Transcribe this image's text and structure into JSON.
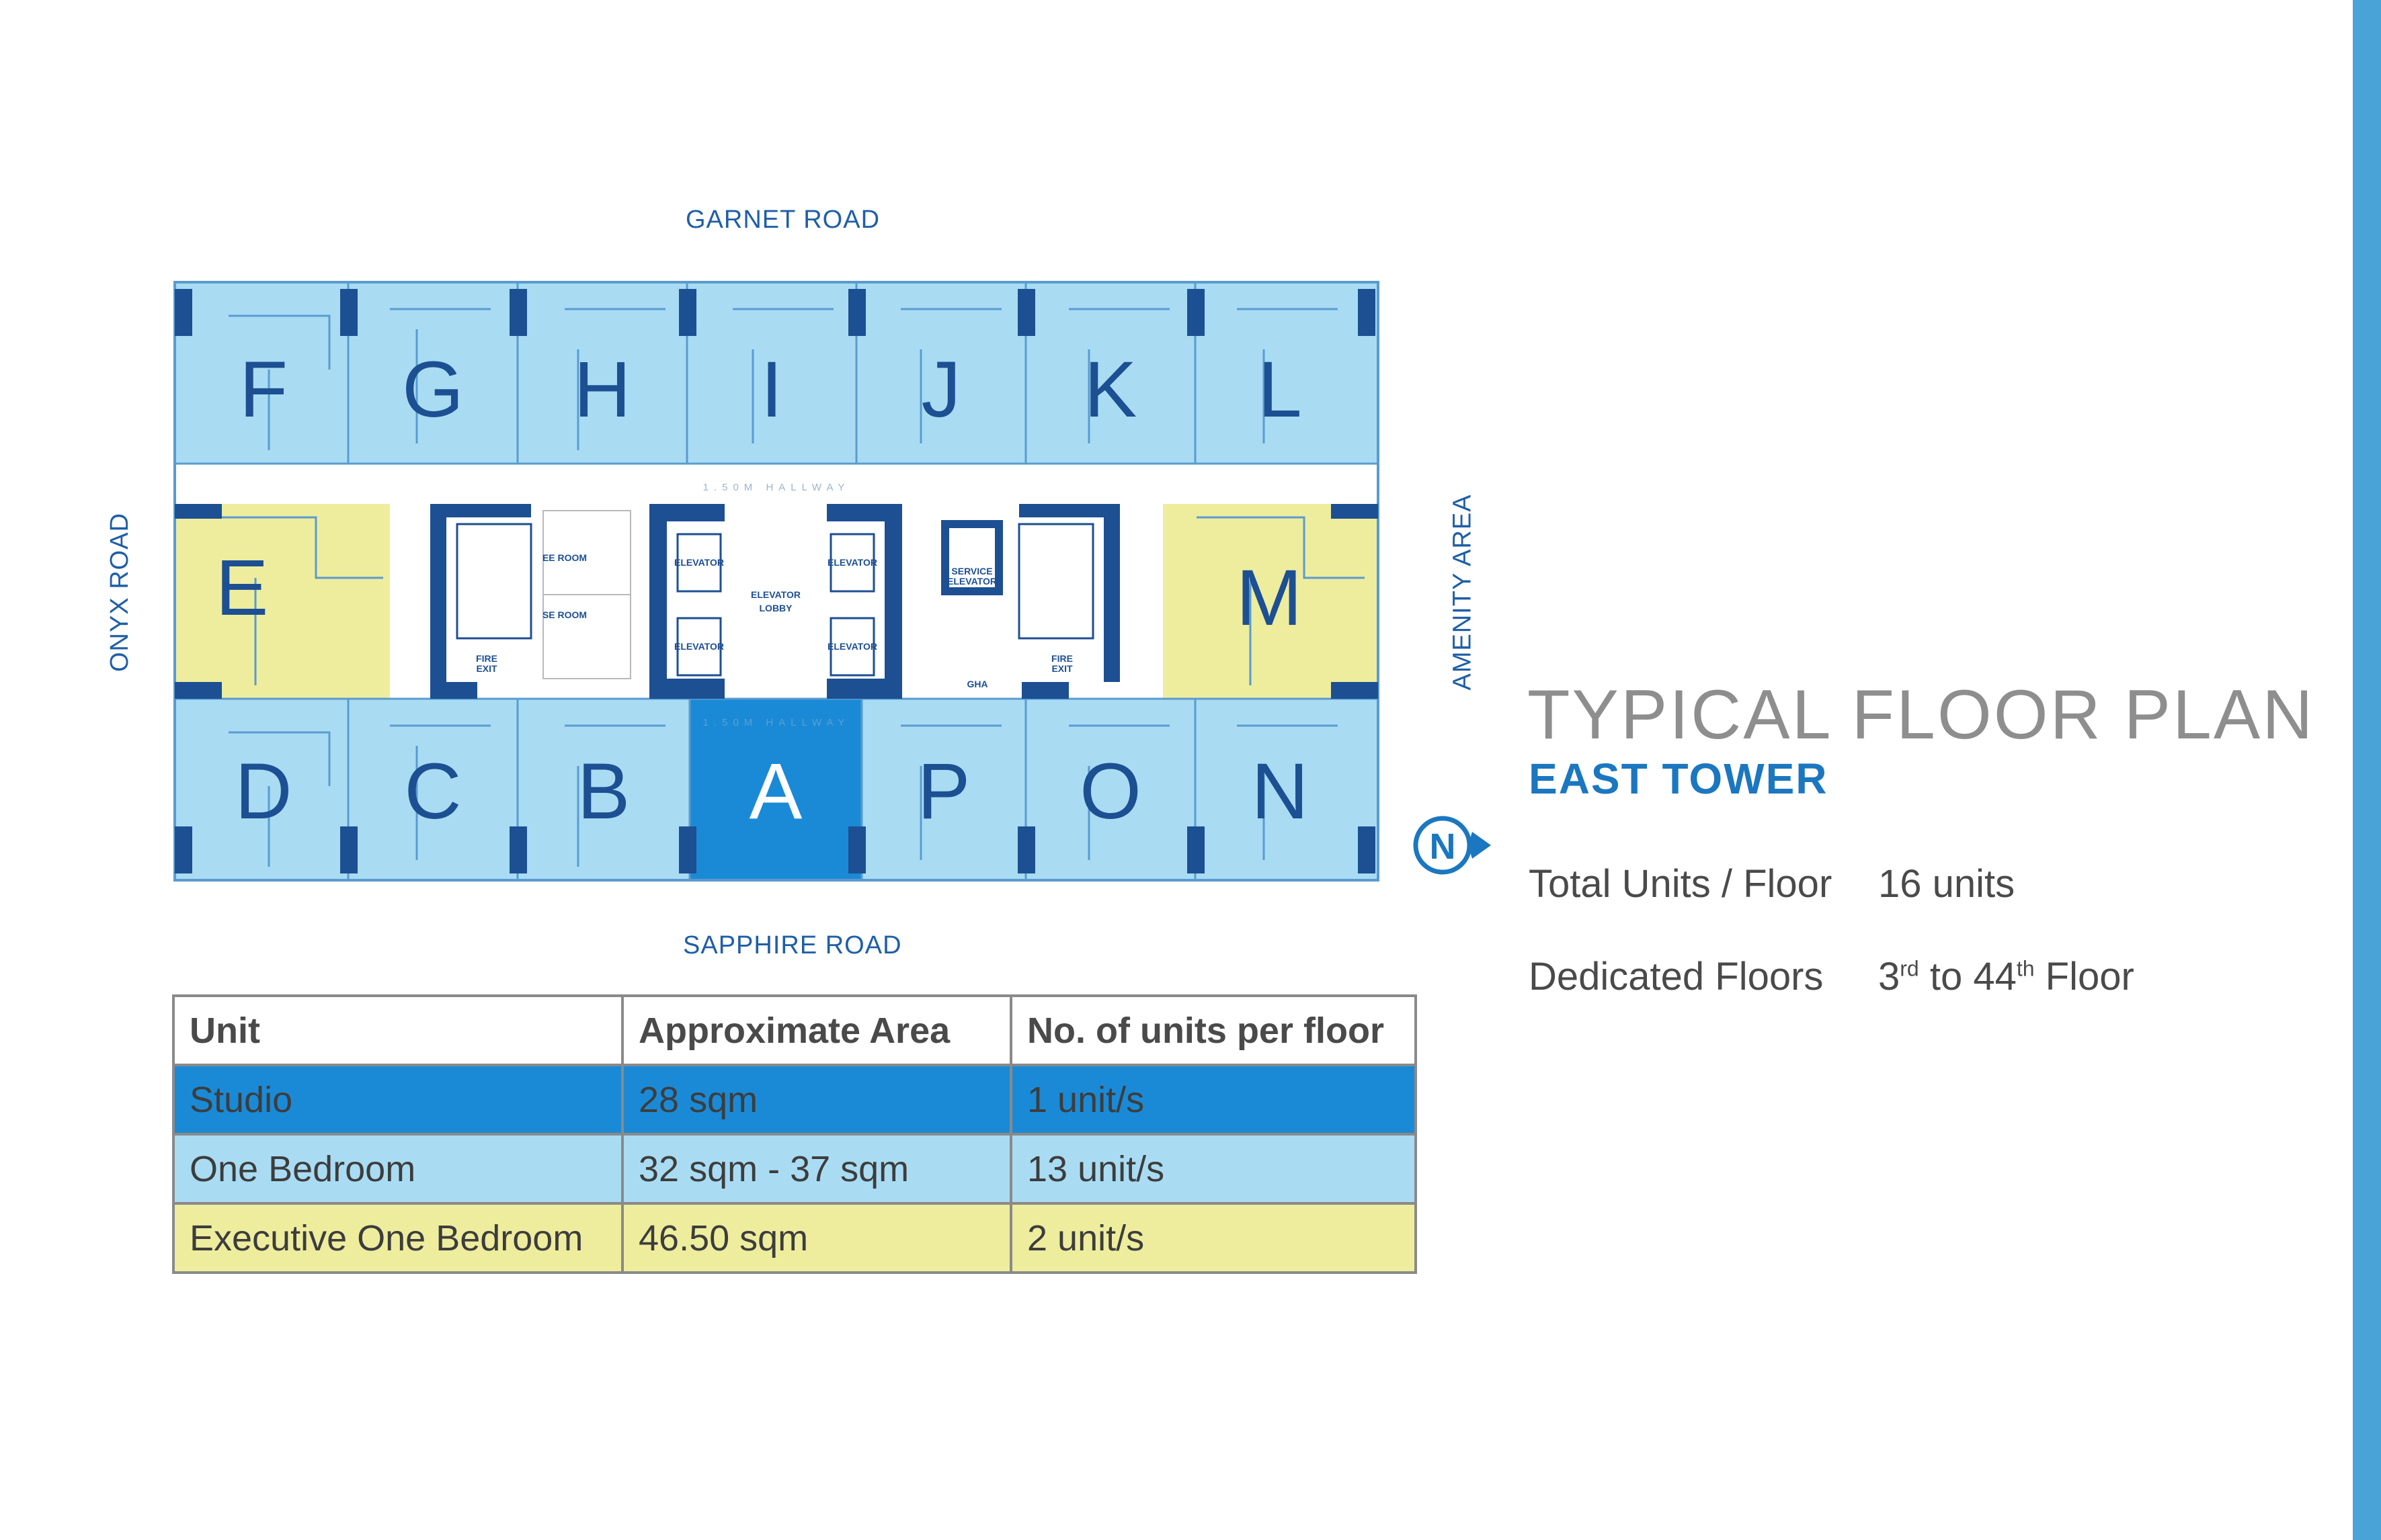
{
  "roads": {
    "north": "GARNET ROAD",
    "south": "SAPPHIRE ROAD",
    "west": "ONYX ROAD",
    "east": "AMENITY AREA"
  },
  "colors": {
    "one_bedroom": "#a9dcf3",
    "studio": "#1a8ad6",
    "executive": "#eeed9e",
    "dark_blue": "#1d4f93",
    "accent_bar": "#4aa3d6",
    "title_gray": "#8e8e8e",
    "subtitle_blue": "#1b77c0"
  },
  "units_top": [
    "F",
    "G",
    "H",
    "I",
    "J",
    "K",
    "L"
  ],
  "units_bottom": [
    "D",
    "C",
    "B",
    "A",
    "P",
    "O",
    "N"
  ],
  "units_side": [
    "E",
    "M"
  ],
  "core_labels": {
    "ee_room": "EE ROOM",
    "se_room": "SE ROOM",
    "elevator": "ELEVATOR",
    "elevator_lobby_1": "ELEVATOR",
    "elevator_lobby_2": "LOBBY",
    "service_elevator_1": "SERVICE",
    "service_elevator_2": "ELEVATOR",
    "fire_exit_1": "FIRE",
    "fire_exit_2": "EXIT",
    "gha": "GHA",
    "hallway": "1.50M HALLWAY"
  },
  "compass": {
    "letter": "N",
    "icon": "north-arrow-icon"
  },
  "heading": {
    "title": "TYPICAL FLOOR PLAN",
    "subtitle": "EAST TOWER"
  },
  "stats": {
    "total_label": "Total Units / Floor",
    "total_value": "16 units",
    "floors_label": "Dedicated Floors",
    "floors_from_num": "3",
    "floors_from_sup": "rd",
    "floors_to_word": " to 44",
    "floors_to_sup": "th",
    "floors_end_word": " Floor"
  },
  "table": {
    "headers": [
      "Unit",
      "Approximate Area",
      "No. of units per floor"
    ],
    "rows": [
      {
        "unit": "Studio",
        "area": "28 sqm",
        "count": "1 unit/s",
        "color": "#1a8ad6"
      },
      {
        "unit": "One Bedroom",
        "area": "32 sqm - 37 sqm",
        "count": "13 unit/s",
        "color": "#a9dcf3"
      },
      {
        "unit": "Executive One Bedroom",
        "area": "46.50 sqm",
        "count": "2 unit/s",
        "color": "#eeed9e"
      }
    ]
  }
}
